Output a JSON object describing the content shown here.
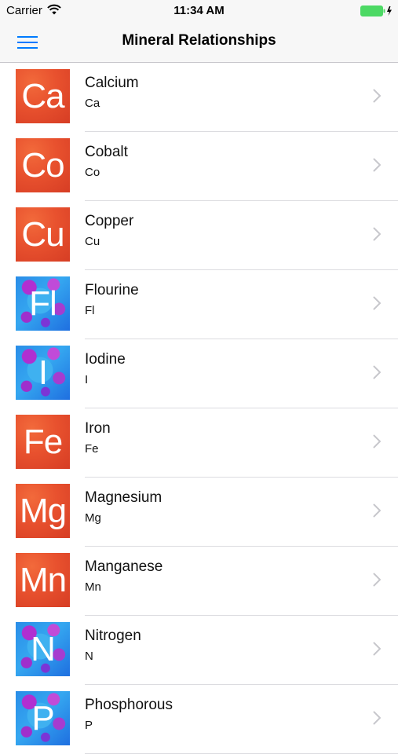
{
  "status_bar": {
    "carrier": "Carrier",
    "time": "11:34 AM",
    "wifi_icon": "wifi-icon",
    "battery_icon": "battery-charging-icon",
    "battery_color": "#4cd964"
  },
  "nav_bar": {
    "title": "Mineral Relationships",
    "menu_icon": "hamburger-menu-icon",
    "accent_color": "#007aff"
  },
  "minerals": [
    {
      "name": "Calcium",
      "symbol": "Ca",
      "tile_style": "red"
    },
    {
      "name": "Cobalt",
      "symbol": "Co",
      "tile_style": "red"
    },
    {
      "name": "Copper",
      "symbol": "Cu",
      "tile_style": "red"
    },
    {
      "name": "Flourine",
      "symbol": "Fl",
      "tile_style": "blue"
    },
    {
      "name": "Iodine",
      "symbol": "I",
      "tile_style": "blue"
    },
    {
      "name": "Iron",
      "symbol": "Fe",
      "tile_style": "red"
    },
    {
      "name": "Magnesium",
      "symbol": "Mg",
      "tile_style": "red"
    },
    {
      "name": "Manganese",
      "symbol": "Mn",
      "tile_style": "red"
    },
    {
      "name": "Nitrogen",
      "symbol": "N",
      "tile_style": "blue"
    },
    {
      "name": "Phosphorous",
      "symbol": "P",
      "tile_style": "blue"
    }
  ],
  "row_chevron_icon": "chevron-right-icon"
}
